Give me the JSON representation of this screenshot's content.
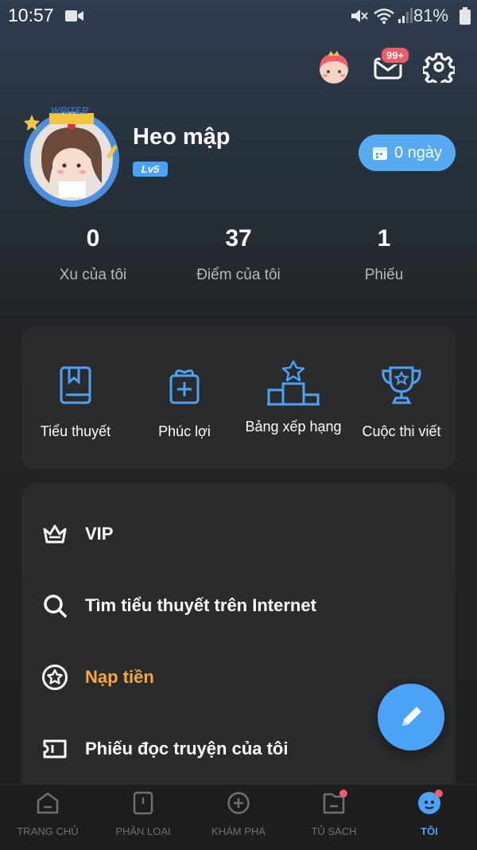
{
  "status_bar": {
    "time": "10:57",
    "battery": "81%"
  },
  "header": {
    "mail_badge": "99+"
  },
  "profile": {
    "avatar_frame_text": "WRITER",
    "name": "Heo mập",
    "level": "Lv5",
    "streak_button": "0 ngày"
  },
  "stats": [
    {
      "value": "0",
      "label": "Xu của tôi"
    },
    {
      "value": "37",
      "label": "Điểm của tôi"
    },
    {
      "value": "1",
      "label": "Phiếu"
    }
  ],
  "shortcuts": [
    {
      "label": "Tiểu thuyết",
      "icon": "book-icon"
    },
    {
      "label": "Phúc lợi",
      "icon": "gift-icon"
    },
    {
      "label": "Bảng xếp hạng",
      "icon": "podium-icon"
    },
    {
      "label": "Cuộc thi viết",
      "icon": "trophy-icon"
    }
  ],
  "menu": [
    {
      "label": "VIP",
      "icon": "crown-icon"
    },
    {
      "label": "Tìm tiểu thuyết trên Internet",
      "icon": "search-icon"
    },
    {
      "label": "Nạp tiền",
      "icon": "star-coin-icon",
      "color": "#f7a93a"
    },
    {
      "label": "Phiếu đọc truyện của tôi",
      "icon": "ticket-icon"
    }
  ],
  "bottom_nav": [
    {
      "label": "TRANG CHỦ",
      "icon": "home-icon"
    },
    {
      "label": "PHÂN LOẠI",
      "icon": "category-icon"
    },
    {
      "label": "KHÁM PHÁ",
      "icon": "explore-icon"
    },
    {
      "label": "TỦ SÁCH",
      "icon": "bookshelf-icon"
    },
    {
      "label": "TÔI",
      "icon": "me-icon",
      "active": true
    }
  ],
  "colors": {
    "accent": "#4aa3f7",
    "recharge": "#f7a93a",
    "badge": "#f05b66"
  }
}
